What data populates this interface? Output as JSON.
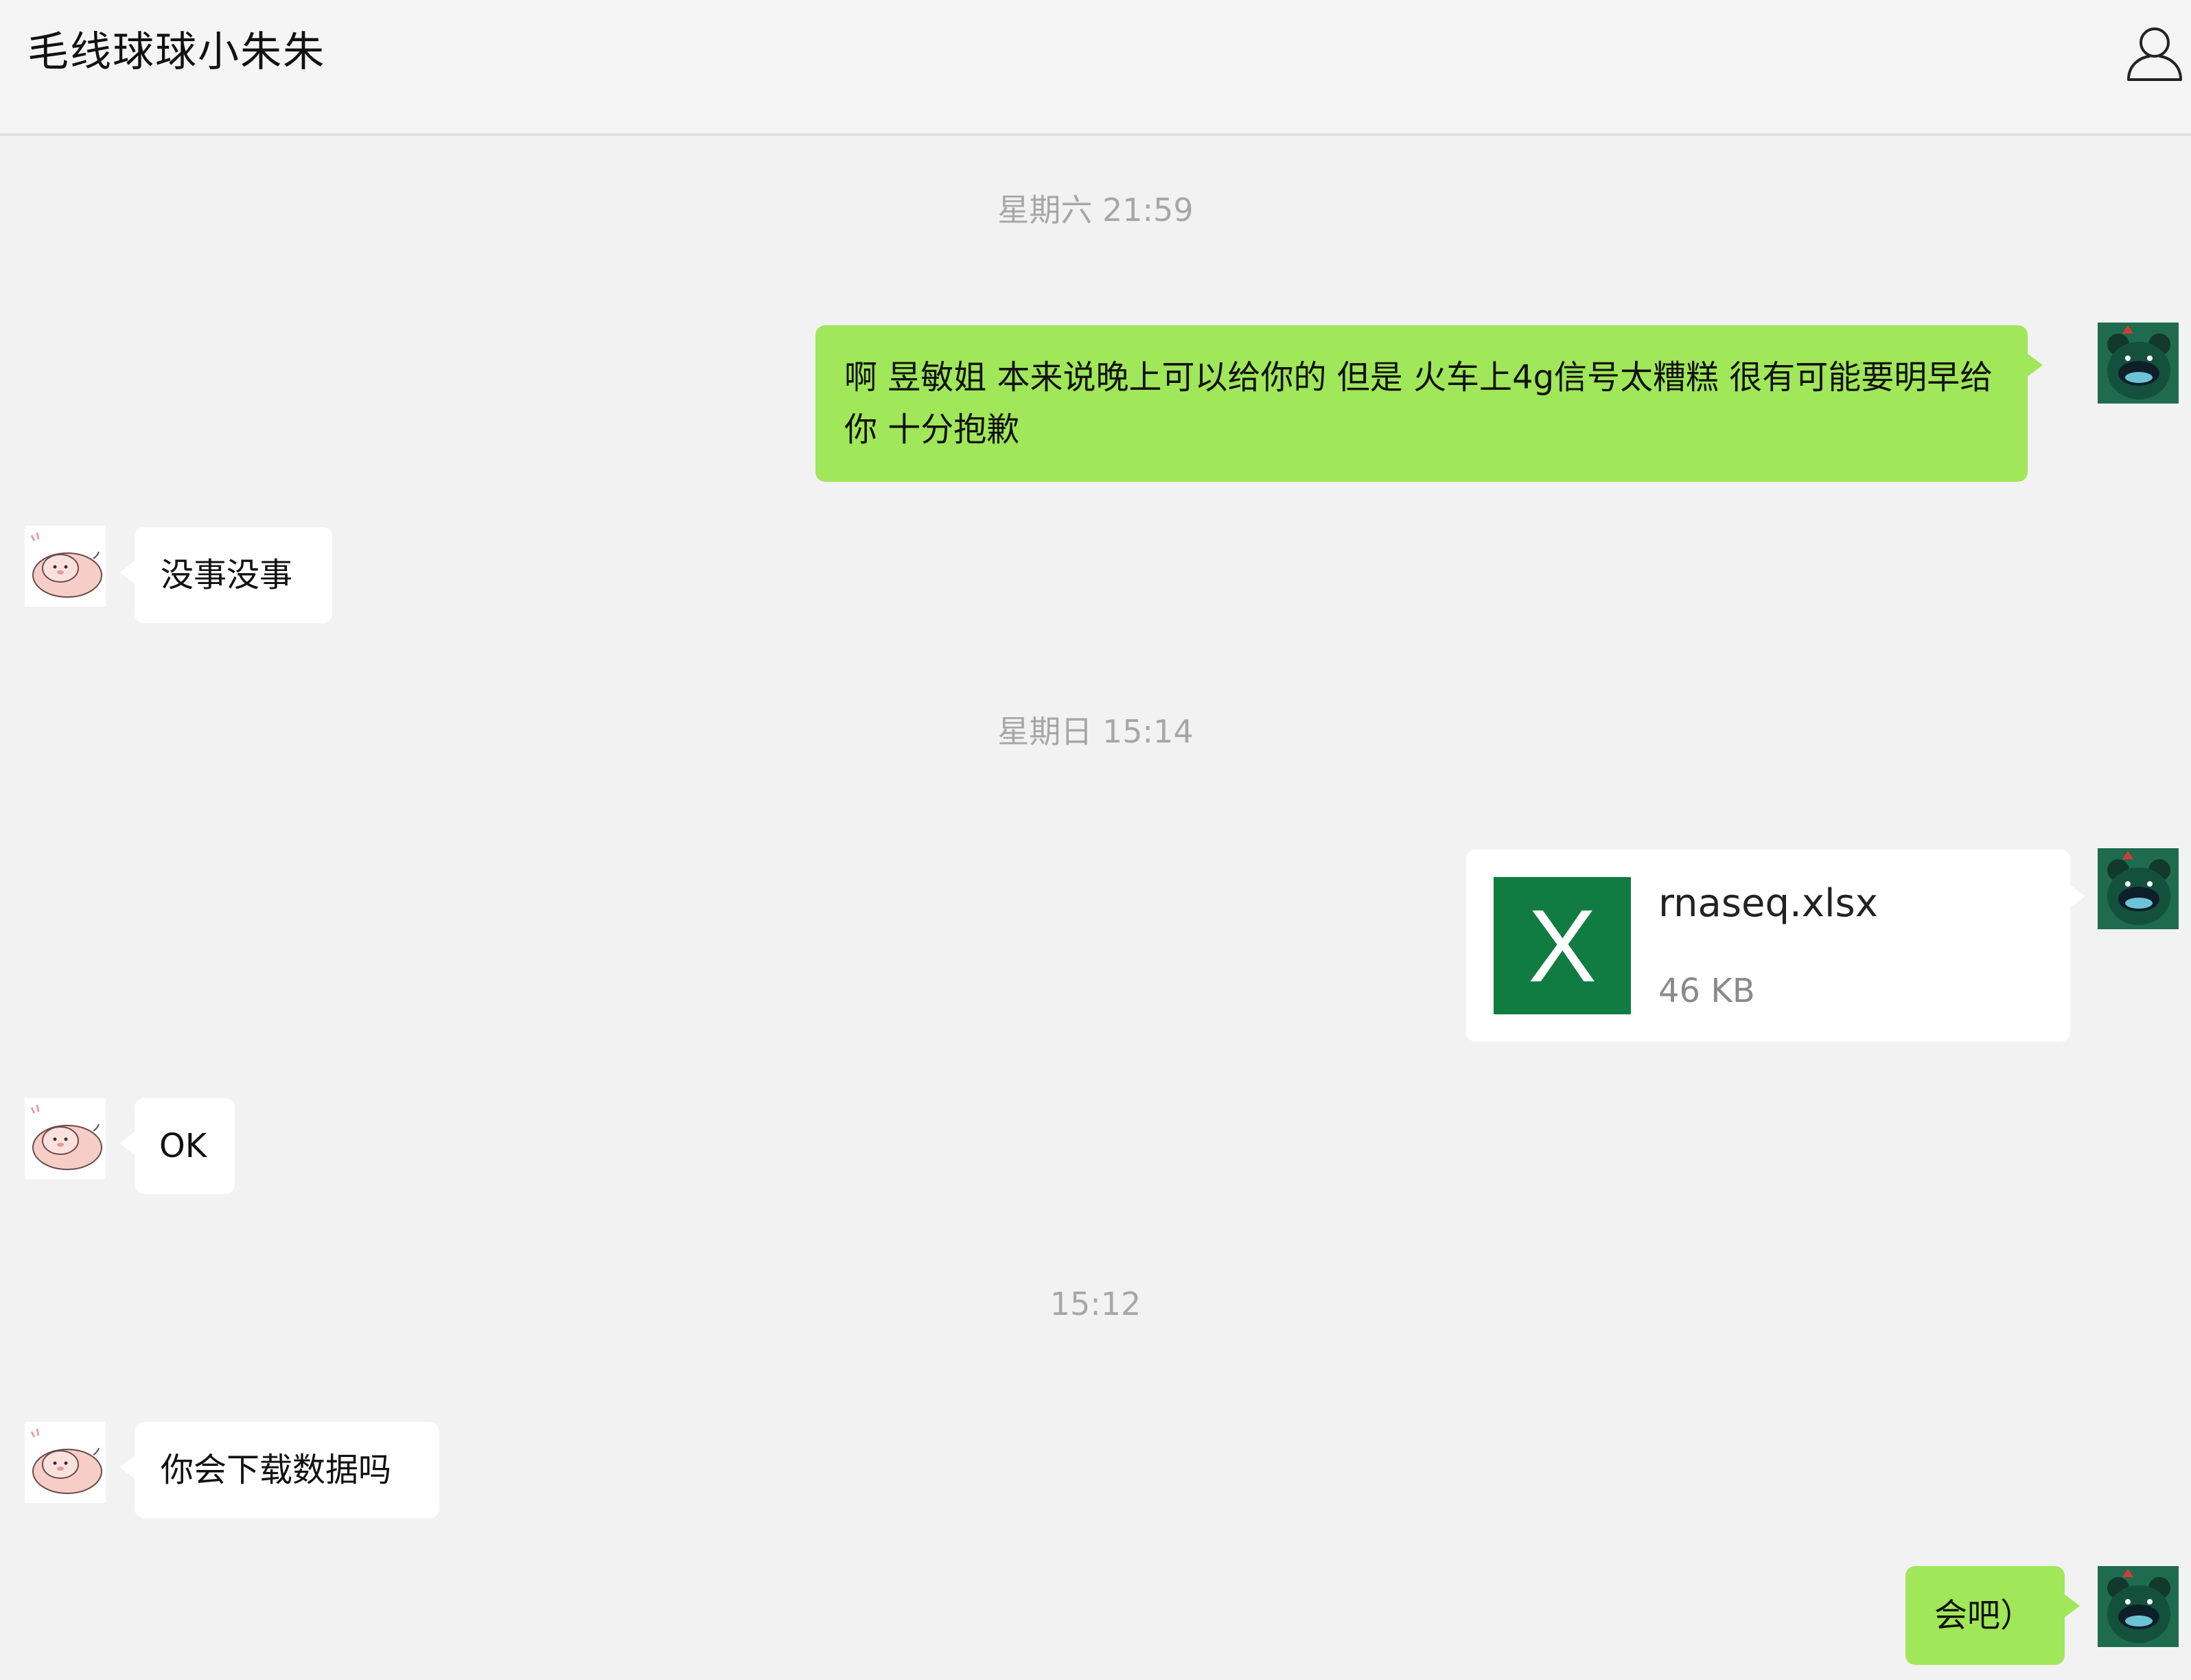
{
  "header": {
    "title": "毛线球球小朱朱",
    "profile_icon": "person-outline-icon"
  },
  "colors": {
    "background": "#f2f2f2",
    "my_bubble": "#a0e759",
    "their_bubble": "#ffffff",
    "excel_green": "#107c41",
    "timestamp_text": "#a7a7a7"
  },
  "messages": {
    "time_1": "星期六 21:59",
    "msg_1": "啊 昱敏姐 本来说晚上可以给你的 但是 火车上4g信号太糟糕 很有可能要明早给你 十分抱歉",
    "msg_2": "没事没事",
    "time_2": "星期日 15:14",
    "file": {
      "icon_letter": "X",
      "name": "rnaseq.xlsx",
      "size": "46 KB"
    },
    "msg_3": "OK",
    "time_3": "15:12",
    "msg_4": "你会下载数据吗",
    "msg_5": "会吧）"
  }
}
